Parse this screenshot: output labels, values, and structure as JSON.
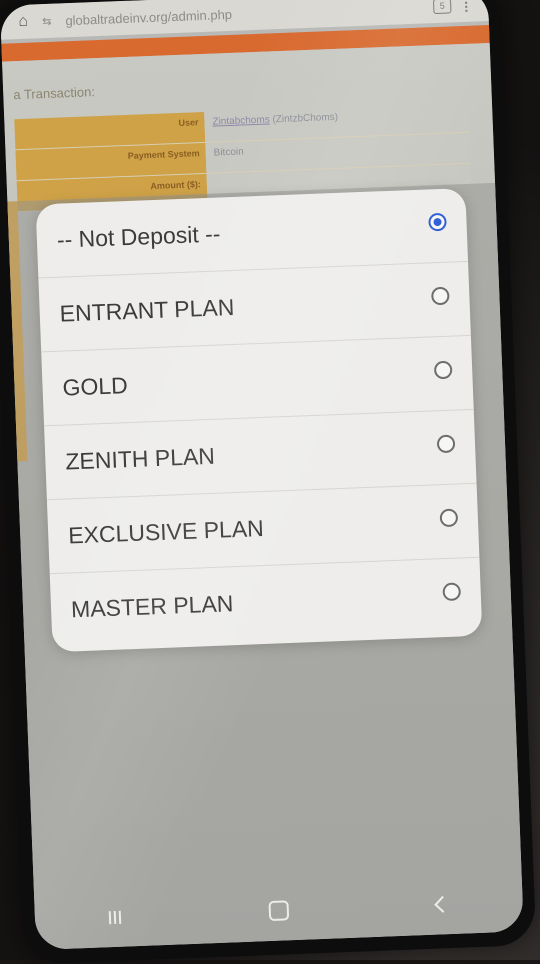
{
  "browser": {
    "url": "globaltradeinv.org/admin.php",
    "tab_count": "5"
  },
  "page": {
    "section_title": "a Transaction:",
    "rows": [
      {
        "label": "User",
        "value": "Zintabchoms",
        "value_extra": "(ZintzbChoms)"
      },
      {
        "label": "Payment System",
        "value": "Bitcoin"
      },
      {
        "label": "Amount ($):",
        "value": ""
      }
    ]
  },
  "dialog": {
    "options": [
      {
        "label": "-- Not Deposit --",
        "selected": true
      },
      {
        "label": "ENTRANT PLAN",
        "selected": false
      },
      {
        "label": "GOLD",
        "selected": false
      },
      {
        "label": "ZENITH PLAN",
        "selected": false
      },
      {
        "label": "EXCLUSIVE PLAN",
        "selected": false
      },
      {
        "label": "MASTER PLAN",
        "selected": false
      }
    ]
  },
  "colors": {
    "accent_orange": "#d86a2f",
    "label_gold": "#cfa248",
    "radio_selected": "#2f5fd6"
  }
}
